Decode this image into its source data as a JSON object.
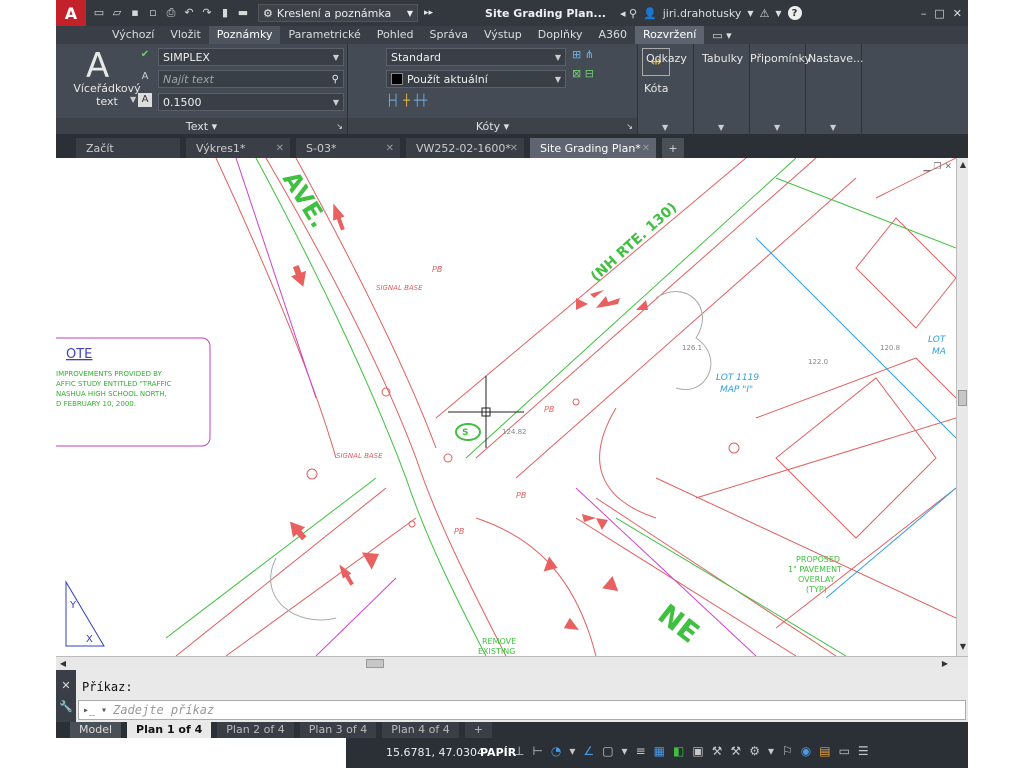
{
  "titlebar": {
    "workspace": "Kreslení a poznámka",
    "title": "Site Grading Plan...",
    "user": "jiri.drahotusky"
  },
  "ribbon_tabs": [
    "Výchozí",
    "Vložit",
    "Poznámky",
    "Parametrické",
    "Pohled",
    "Správa",
    "Výstup",
    "Doplňky",
    "A360",
    "Rozvržení"
  ],
  "text_panel": {
    "multiline_label": "Víceřádkový text",
    "font_style": "SIMPLEX",
    "find_placeholder": "Najít text",
    "text_height": "0.1500",
    "footer": "Text"
  },
  "dim_panel": {
    "dim_style": "Standard",
    "layer": "Použít aktuální",
    "kota_label": "Kóta",
    "footer": "Kóty"
  },
  "side_panels": [
    "Odkazy",
    "Tabulky",
    "Připomínky",
    "Nastave..."
  ],
  "file_tabs": [
    {
      "label": "Začít"
    },
    {
      "label": "Výkres1*"
    },
    {
      "label": "S-03*"
    },
    {
      "label": "VW252-02-1600*"
    },
    {
      "label": "Site Grading Plan*"
    }
  ],
  "drawing": {
    "note_title": "OTE",
    "note_lines": [
      "IMPROVEMENTS PROVIDED BY",
      "AFFIC STUDY ENTITLED \"TRAFFIC",
      "NASHUA HIGH SCHOOL NORTH,",
      "D FEBRUARY 10, 2000."
    ],
    "street_top": "AVE.",
    "route": "(NH RTE. 130)",
    "signal_base": "SIGNAL BASE",
    "lot_label": "LOT 1119",
    "map_label": "MAP \"I\"",
    "lot_right": "LOT",
    "map_right": "MA",
    "proposed": [
      "PROPOSED",
      "1\" PAVEMENT",
      "OVERLAY",
      "(TYP)"
    ],
    "remove": [
      "REMOVE",
      "EXISTING"
    ],
    "ne": "NE",
    "pb": "PB",
    "elev1": "122.0",
    "elev2": "120.8",
    "elev3": "126.1",
    "elev4": "124.82"
  },
  "command": {
    "history": "Příkaz:",
    "placeholder": "Zadejte příkaz"
  },
  "layout_tabs": [
    "Model",
    "Plan 1 of 4",
    "Plan 2 of 4",
    "Plan 3 of 4",
    "Plan 4 of 4"
  ],
  "status": {
    "coords": "15.6781, 47.0304",
    "space": "PAPÍR"
  }
}
